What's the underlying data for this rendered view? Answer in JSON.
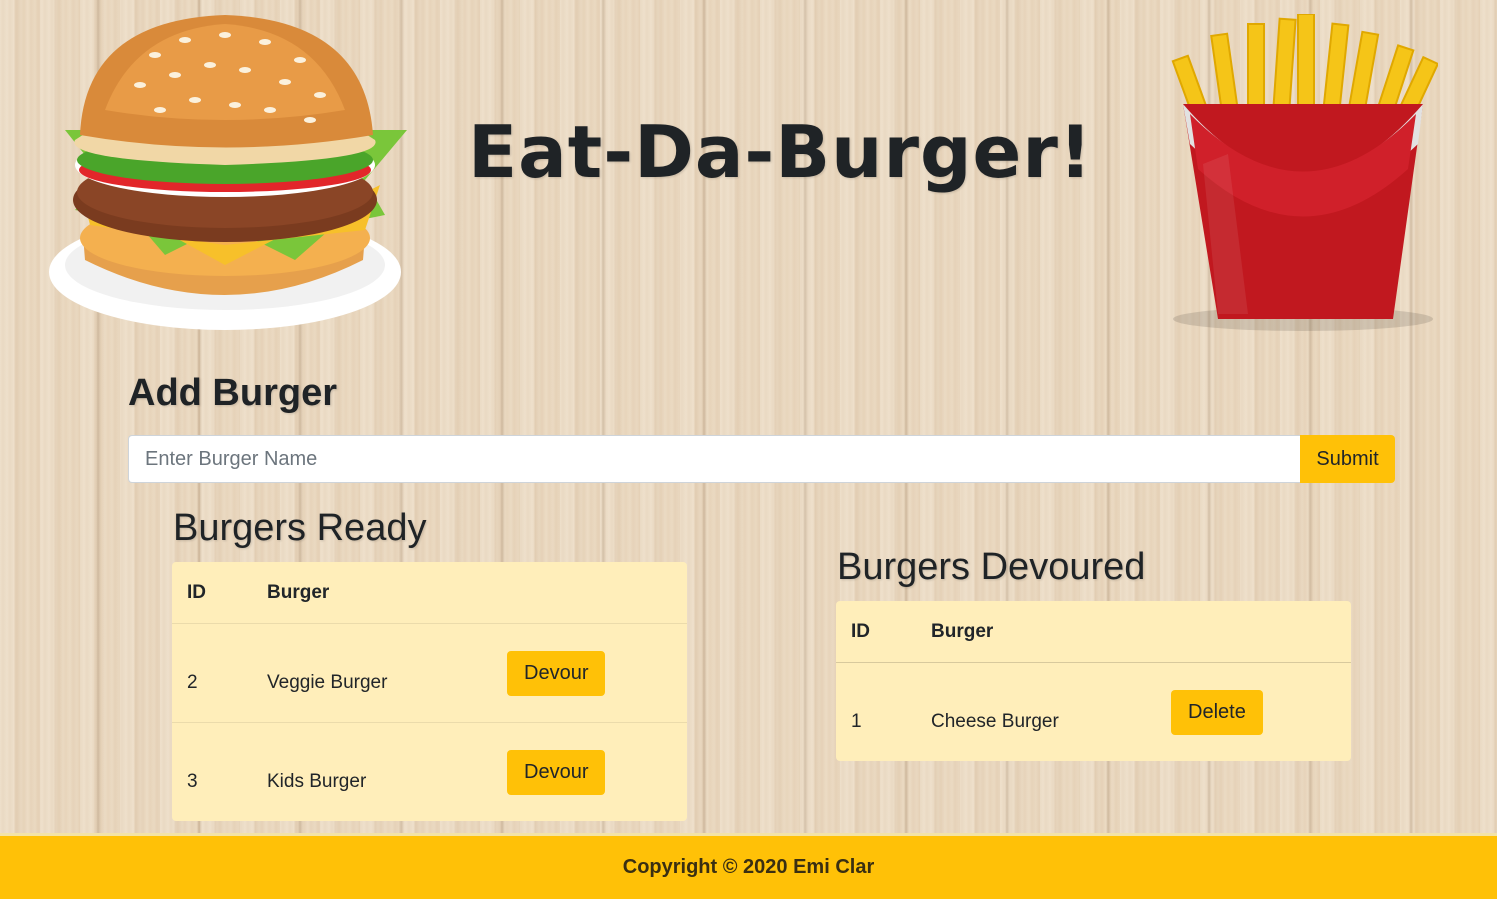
{
  "header": {
    "title": "Eat-Da-Burger!"
  },
  "images": {
    "left": "burger-icon",
    "right": "fries-icon"
  },
  "add_form": {
    "heading": "Add Burger",
    "placeholder": "Enter Burger Name",
    "submit_label": "Submit"
  },
  "ready": {
    "heading": "Burgers Ready",
    "columns": [
      "ID",
      "Burger"
    ],
    "rows": [
      {
        "id": "2",
        "name": "Veggie Burger",
        "action": "Devour"
      },
      {
        "id": "3",
        "name": "Kids Burger",
        "action": "Devour"
      }
    ]
  },
  "devoured": {
    "heading": "Burgers Devoured",
    "columns": [
      "ID",
      "Burger"
    ],
    "rows": [
      {
        "id": "1",
        "name": "Cheese Burger",
        "action": "Delete"
      }
    ]
  },
  "footer": {
    "text": "Copyright © 2020 Emi Clar"
  },
  "colors": {
    "accent": "#ffc107",
    "table_bg": "#ffeeba",
    "text": "#1f2326"
  }
}
